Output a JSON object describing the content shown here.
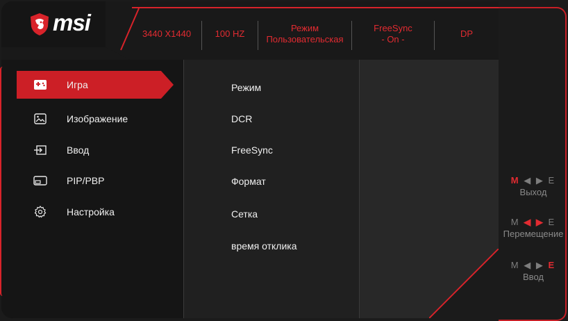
{
  "brand": {
    "logo_text": "msi",
    "accent": "#d8232a"
  },
  "status": [
    {
      "id": "resolution",
      "lines": [
        "3440 X1440"
      ]
    },
    {
      "id": "refresh",
      "lines": [
        "100 HZ"
      ]
    },
    {
      "id": "mode",
      "lines": [
        "Режим",
        "Пользовательская"
      ]
    },
    {
      "id": "freesync",
      "lines": [
        "FreeSync",
        "- On -"
      ]
    },
    {
      "id": "input",
      "lines": [
        "DP"
      ]
    }
  ],
  "menu": {
    "items": [
      {
        "label": "Игра",
        "icon": "gamepad-icon",
        "active": true
      },
      {
        "label": "Изображение",
        "icon": "image-icon",
        "active": false
      },
      {
        "label": "Ввод",
        "icon": "input-source-icon",
        "active": false
      },
      {
        "label": "PIP/PBP",
        "icon": "pip-icon",
        "active": false
      },
      {
        "label": "Настройка",
        "icon": "settings-gear-icon",
        "active": false
      }
    ]
  },
  "submenu": {
    "items": [
      "Режим",
      "DCR",
      "FreeSync",
      "Формат",
      "Сетка",
      "время отклика"
    ]
  },
  "hints": [
    {
      "keys": [
        "M",
        "◀",
        "▶",
        "E"
      ],
      "highlight": [
        0
      ],
      "caption": "Выход"
    },
    {
      "keys": [
        "M",
        "◀",
        "▶",
        "E"
      ],
      "highlight": [
        1,
        2
      ],
      "caption": "Перемещение"
    },
    {
      "keys": [
        "M",
        "◀",
        "▶",
        "E"
      ],
      "highlight": [
        3
      ],
      "caption": "Ввод"
    }
  ]
}
